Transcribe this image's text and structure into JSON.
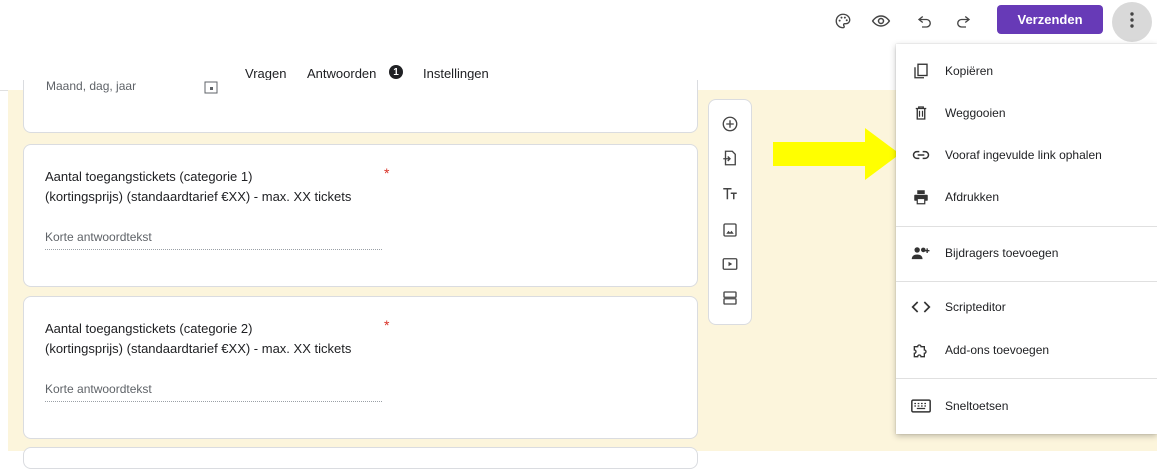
{
  "topbar": {
    "icons": [
      "palette-icon",
      "eye-icon",
      "undo-icon",
      "redo-icon"
    ],
    "send_label": "Verzenden",
    "more_icon": "more-vert-icon"
  },
  "tabs": [
    {
      "label": "Vragen",
      "active": true
    },
    {
      "label": "Antwoorden",
      "badge": "1"
    },
    {
      "label": "Instellingen"
    }
  ],
  "form": {
    "partial_card": {
      "placeholder": "Maand, dag, jaar"
    },
    "questions": [
      {
        "line1": "Aantal toegangstickets (categorie 1)",
        "line2": "(kortingsprijs) (standaardtarief €XX) -  max. XX tickets",
        "required_mark": "*",
        "answer_placeholder": "Korte antwoordtekst"
      },
      {
        "line1": "Aantal toegangstickets (categorie 2)",
        "line2": "(kortingsprijs) (standaardtarief €XX) -  max. XX tickets",
        "required_mark": "*",
        "answer_placeholder": "Korte antwoordtekst"
      }
    ]
  },
  "side_toolbar": [
    "add-question-icon",
    "import-questions-icon",
    "add-title-icon",
    "add-image-icon",
    "add-video-icon",
    "add-section-icon"
  ],
  "annotation": {
    "arrow_color": "#ffff00"
  },
  "menu": {
    "items": [
      {
        "label": "Kopiëren",
        "icon": "copy-icon"
      },
      {
        "label": "Weggooien",
        "icon": "trash-icon"
      },
      {
        "label": "Vooraf ingevulde link ophalen",
        "icon": "link-icon"
      },
      {
        "label": "Afdrukken",
        "icon": "print-icon"
      },
      {
        "label": "Bijdragers toevoegen",
        "icon": "add-people-icon"
      },
      {
        "label": "Scripteditor",
        "icon": "code-icon"
      },
      {
        "label": "Add-ons toevoegen",
        "icon": "puzzle-icon"
      },
      {
        "label": "Sneltoetsen",
        "icon": "keyboard-icon"
      }
    ]
  },
  "colors": {
    "accent": "#673ab7",
    "canvas": "#fcf5dc",
    "tab_underline": "#7a5c00",
    "required": "#d93025"
  }
}
